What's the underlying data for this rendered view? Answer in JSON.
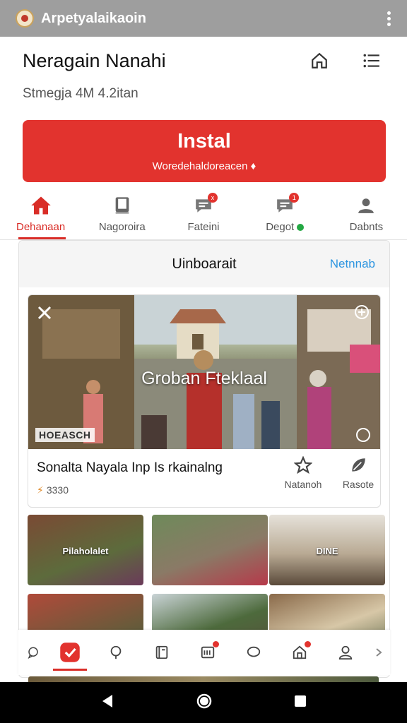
{
  "status_bar": {
    "app_name": "Arpetyalaikaoin"
  },
  "header": {
    "title": "Neragain Nanahi",
    "subtitle": "Stmegja 4M 4.2itan"
  },
  "install": {
    "label": "Instal",
    "sublabel": "Woredehaldoreacen ♦"
  },
  "tabs": [
    {
      "label": "Dehanaan",
      "icon": "home-icon",
      "active": true
    },
    {
      "label": "Nagoroira",
      "icon": "book-icon",
      "active": false
    },
    {
      "label": "Fateini",
      "icon": "chat-icon",
      "badge": "x",
      "active": false
    },
    {
      "label": "Degot",
      "icon": "chat-icon",
      "badge": "1",
      "online": true,
      "active": false
    },
    {
      "label": "Dabnts",
      "icon": "user-icon",
      "active": false
    }
  ],
  "panel": {
    "title": "Uinboarait",
    "link": "Netnnab"
  },
  "feature": {
    "overlay_title": "Groban Fteklaal",
    "label": "HOEASCH",
    "name": "Sonalta Nayala Inp Is rkainalng",
    "count": "3330",
    "actions": [
      {
        "label": "Natanoh",
        "icon": "star-icon"
      },
      {
        "label": "Rasote",
        "icon": "leaf-icon"
      }
    ]
  },
  "thumbnails": [
    {
      "label": "Pilaholalet"
    },
    {
      "label": ""
    },
    {
      "label": "DINE"
    },
    {
      "label": ""
    },
    {
      "label": ""
    },
    {
      "label": ""
    }
  ],
  "dock": [
    {
      "icon": "chat-bubble-icon"
    },
    {
      "icon": "video-app-icon",
      "active": true
    },
    {
      "icon": "search-icon"
    },
    {
      "icon": "book-icon"
    },
    {
      "icon": "news-icon",
      "badge": true
    },
    {
      "icon": "message-icon"
    },
    {
      "icon": "home-icon",
      "badge": true
    },
    {
      "icon": "user-icon"
    },
    {
      "icon": "chevron-right-icon"
    }
  ],
  "colors": {
    "accent": "#e2332e",
    "link": "#2d95e0",
    "status_bar": "#9e9e9e",
    "online": "#23a843"
  }
}
